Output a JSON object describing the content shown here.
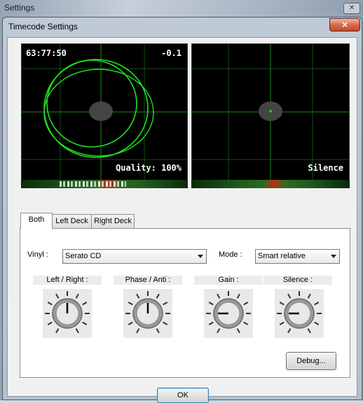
{
  "outer_window": {
    "title": "Settings"
  },
  "dialog": {
    "title": "Timecode Settings",
    "close_label": "×"
  },
  "scopes": {
    "left": {
      "timecode": "63:77:50",
      "offset": "-0.1",
      "status": "Quality: 100%"
    },
    "right": {
      "status": "Silence"
    }
  },
  "tabs": [
    {
      "label": "Both",
      "active": true
    },
    {
      "label": "Left Deck",
      "active": false
    },
    {
      "label": "Right Deck",
      "active": false
    }
  ],
  "vinyl": {
    "label": "Vinyl :",
    "value": "Serato CD"
  },
  "mode": {
    "label": "Mode :",
    "value": "Smart relative"
  },
  "knobs": [
    {
      "label": "Left / Right :",
      "angle": 0
    },
    {
      "label": "Phase / Anti :",
      "angle": 0
    },
    {
      "label": "Gain :",
      "angle": -90
    },
    {
      "label": "Silence :",
      "angle": -90
    }
  ],
  "buttons": {
    "debug": "Debug...",
    "ok": "OK"
  },
  "colors": {
    "scope_trace": "#22e022",
    "scope_grid": "#1f8a1f",
    "close_button": "#c24a2b"
  },
  "icons": {
    "dialog_close": "close-icon",
    "combo_arrow": "chevron-down-icon"
  }
}
